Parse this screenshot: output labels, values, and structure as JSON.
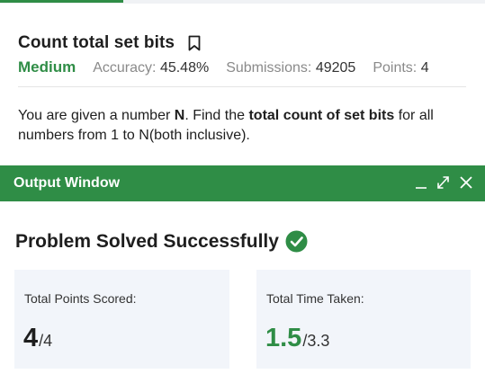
{
  "problem": {
    "title": "Count total set bits",
    "difficulty": "Medium",
    "accuracy_label": "Accuracy:",
    "accuracy_value": "45.48%",
    "submissions_label": "Submissions:",
    "submissions_value": "49205",
    "points_label": "Points:",
    "points_value": "4",
    "statement": {
      "p1": "You are given a number ",
      "n": "N",
      "p2": ". Find the ",
      "bold": "total count of set bits",
      "p3": " for all numbers from 1 to N(both inclusive)."
    }
  },
  "output_window": {
    "title": "Output Window",
    "result_title": "Problem Solved Successfully",
    "points_card": {
      "label": "Total Points Scored:",
      "value": "4",
      "total": "/4"
    },
    "time_card": {
      "label": "Total Time Taken:",
      "value": "1.5",
      "total": "/3.3"
    }
  },
  "colors": {
    "brand_green": "#2f8d46",
    "card_bg": "#f2f5fa"
  },
  "icons": [
    "bookmark-icon",
    "minimize-icon",
    "maximize-icon",
    "close-icon",
    "check-circle-icon"
  ]
}
